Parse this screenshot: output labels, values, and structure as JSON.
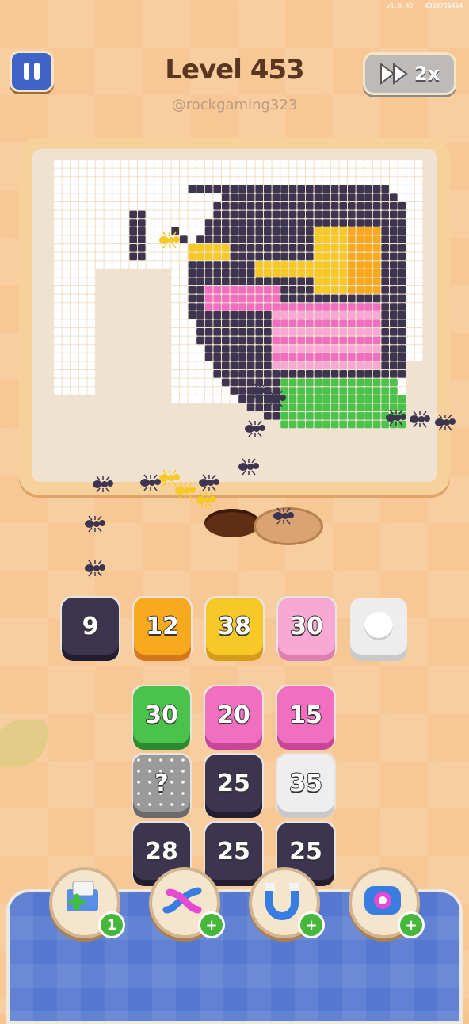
{
  "version": "v1.0.42 - 4908736454",
  "header": {
    "level_title": "Level 453",
    "username": "@rockgaming323",
    "speed_label": "2x"
  },
  "colors": {
    "dark": "#3d3550",
    "yellow": "#f6c927",
    "orange": "#f8a91d",
    "pink": "#f26fc0",
    "light_pink": "#f7a9d3",
    "green": "#4bc24a",
    "white": "#f3f3f3"
  },
  "queue": [
    {
      "value": "9",
      "color": "dark"
    },
    {
      "value": "12",
      "color": "orange"
    },
    {
      "value": "38",
      "color": "yellow"
    },
    {
      "value": "30",
      "color": "light_pink"
    }
  ],
  "stack_grid": [
    [
      {
        "value": "30",
        "color": "green"
      },
      {
        "value": "20",
        "color": "pink"
      },
      {
        "value": "15",
        "color": "pink"
      }
    ],
    [
      {
        "value": "?",
        "color": "mystery"
      },
      {
        "value": "25",
        "color": "dark"
      },
      {
        "value": "35",
        "color": "white"
      }
    ],
    [
      {
        "value": "28",
        "color": "dark"
      },
      {
        "value": "25",
        "color": "dark"
      },
      {
        "value": "25",
        "color": "dark"
      }
    ]
  ],
  "boosters": [
    {
      "name": "add-slot",
      "badge": "1"
    },
    {
      "name": "swap",
      "badge": "+"
    },
    {
      "name": "magnet",
      "badge": "+"
    },
    {
      "name": "blocker",
      "badge": "+"
    }
  ]
}
